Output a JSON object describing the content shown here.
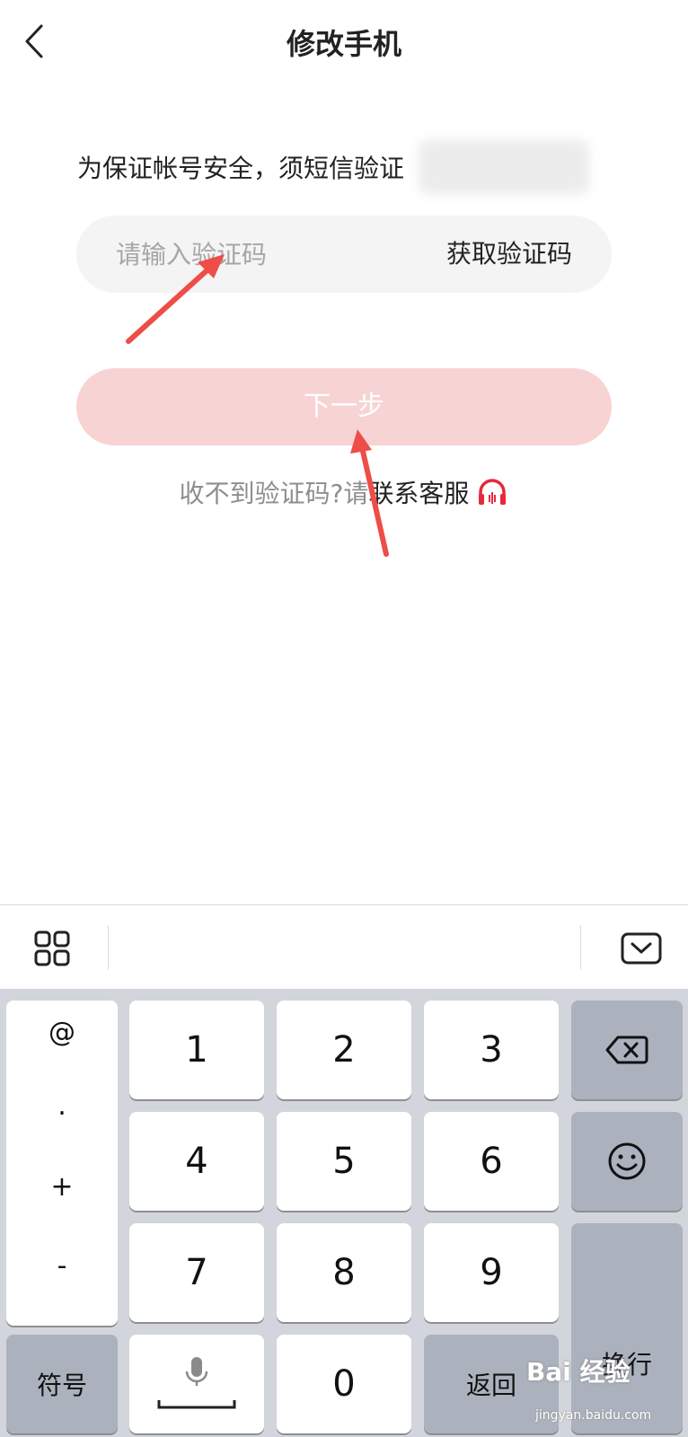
{
  "header": {
    "title": "修改手机"
  },
  "verify": {
    "hint": "为保证帐号安全，须短信验证",
    "code_placeholder": "请输入验证码",
    "get_code_label": "获取验证码",
    "next_label": "下一步",
    "support_prefix": "收不到验证码?请",
    "support_link": "联系客服"
  },
  "colors": {
    "accent": "#e8283c",
    "next_button_disabled": "#f8d3d4",
    "annotation_arrow": "#ee4d48"
  },
  "keyboard": {
    "symbols": [
      "@",
      ".",
      "+",
      "-"
    ],
    "digits": [
      "1",
      "2",
      "3",
      "4",
      "5",
      "6",
      "7",
      "8",
      "9",
      "0"
    ],
    "fuhao_label": "符号",
    "return_label": "返回",
    "enter_label": "换行"
  },
  "watermark": {
    "text": "Bai 经验",
    "sub": "jingyan.baidu.com"
  }
}
